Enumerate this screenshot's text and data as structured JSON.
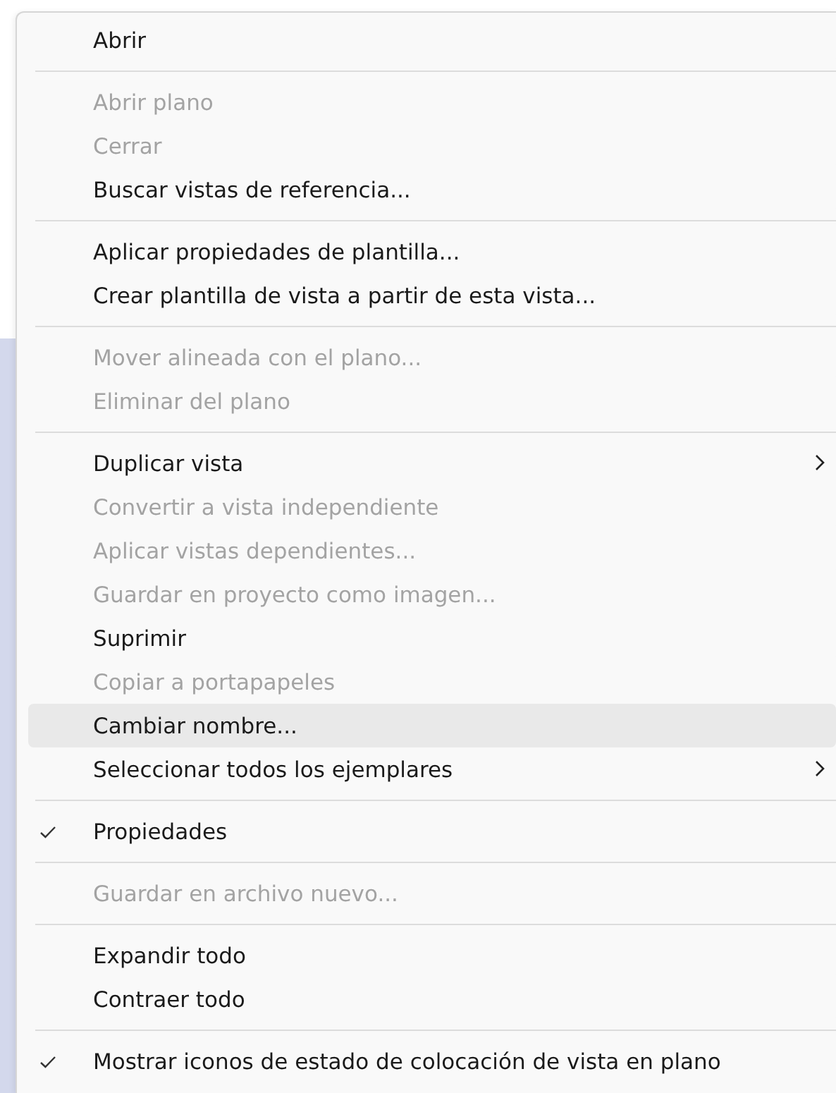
{
  "context_menu": {
    "groups": [
      {
        "items": [
          {
            "label": "Abrir",
            "disabled": false,
            "checked": false,
            "submenu": false,
            "highlighted": false
          }
        ]
      },
      {
        "items": [
          {
            "label": "Abrir plano",
            "disabled": true,
            "checked": false,
            "submenu": false,
            "highlighted": false
          },
          {
            "label": "Cerrar",
            "disabled": true,
            "checked": false,
            "submenu": false,
            "highlighted": false
          },
          {
            "label": "Buscar vistas de referencia...",
            "disabled": false,
            "checked": false,
            "submenu": false,
            "highlighted": false
          }
        ]
      },
      {
        "items": [
          {
            "label": "Aplicar propiedades de plantilla...",
            "disabled": false,
            "checked": false,
            "submenu": false,
            "highlighted": false
          },
          {
            "label": "Crear plantilla de vista a partir de esta vista...",
            "disabled": false,
            "checked": false,
            "submenu": false,
            "highlighted": false
          }
        ]
      },
      {
        "items": [
          {
            "label": "Mover alineada con el plano...",
            "disabled": true,
            "checked": false,
            "submenu": false,
            "highlighted": false
          },
          {
            "label": "Eliminar del plano",
            "disabled": true,
            "checked": false,
            "submenu": false,
            "highlighted": false
          }
        ]
      },
      {
        "items": [
          {
            "label": "Duplicar vista",
            "disabled": false,
            "checked": false,
            "submenu": true,
            "highlighted": false
          },
          {
            "label": "Convertir a vista independiente",
            "disabled": true,
            "checked": false,
            "submenu": false,
            "highlighted": false
          },
          {
            "label": "Aplicar vistas dependientes...",
            "disabled": true,
            "checked": false,
            "submenu": false,
            "highlighted": false
          },
          {
            "label": "Guardar en proyecto como imagen...",
            "disabled": true,
            "checked": false,
            "submenu": false,
            "highlighted": false
          },
          {
            "label": "Suprimir",
            "disabled": false,
            "checked": false,
            "submenu": false,
            "highlighted": false
          },
          {
            "label": "Copiar a portapapeles",
            "disabled": true,
            "checked": false,
            "submenu": false,
            "highlighted": false
          },
          {
            "label": "Cambiar nombre...",
            "disabled": false,
            "checked": false,
            "submenu": false,
            "highlighted": true
          },
          {
            "label": "Seleccionar todos los ejemplares",
            "disabled": false,
            "checked": false,
            "submenu": true,
            "highlighted": false
          }
        ]
      },
      {
        "items": [
          {
            "label": "Propiedades",
            "disabled": false,
            "checked": true,
            "submenu": false,
            "highlighted": false
          }
        ]
      },
      {
        "items": [
          {
            "label": "Guardar en archivo nuevo...",
            "disabled": true,
            "checked": false,
            "submenu": false,
            "highlighted": false
          }
        ]
      },
      {
        "items": [
          {
            "label": "Expandir todo",
            "disabled": false,
            "checked": false,
            "submenu": false,
            "highlighted": false
          },
          {
            "label": "Contraer todo",
            "disabled": false,
            "checked": false,
            "submenu": false,
            "highlighted": false
          }
        ]
      },
      {
        "items": [
          {
            "label": "Mostrar iconos de estado de colocación de vista en plano",
            "disabled": false,
            "checked": true,
            "submenu": false,
            "highlighted": false
          }
        ]
      }
    ]
  }
}
